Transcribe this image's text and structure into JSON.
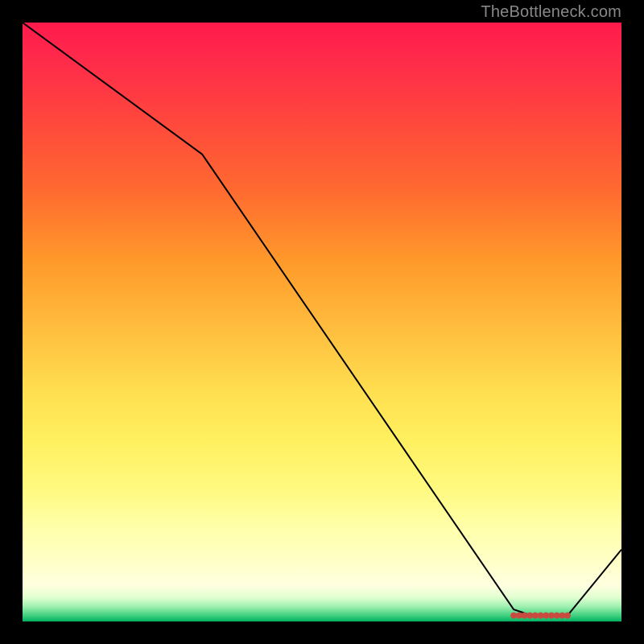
{
  "watermark": "TheBottleneck.com",
  "chart_data": {
    "type": "line",
    "title": "",
    "xlabel": "",
    "ylabel": "",
    "xlim": [
      0,
      100
    ],
    "ylim": [
      0,
      100
    ],
    "background_gradient": {
      "top": "#ff1a4d",
      "mid": "#ffe050",
      "bottom": "#00b060",
      "meaning": "red high / green low"
    },
    "series": [
      {
        "name": "black-line",
        "color": "#000000",
        "stroke_width": 2,
        "x": [
          0,
          30,
          82,
          85,
          91,
          100
        ],
        "values": [
          100,
          78,
          2,
          1,
          1,
          12
        ]
      },
      {
        "name": "red-marker-band",
        "color": "#c94a3f",
        "type": "marker-band",
        "y": 1,
        "x_start": 82,
        "x_end": 91
      }
    ]
  }
}
